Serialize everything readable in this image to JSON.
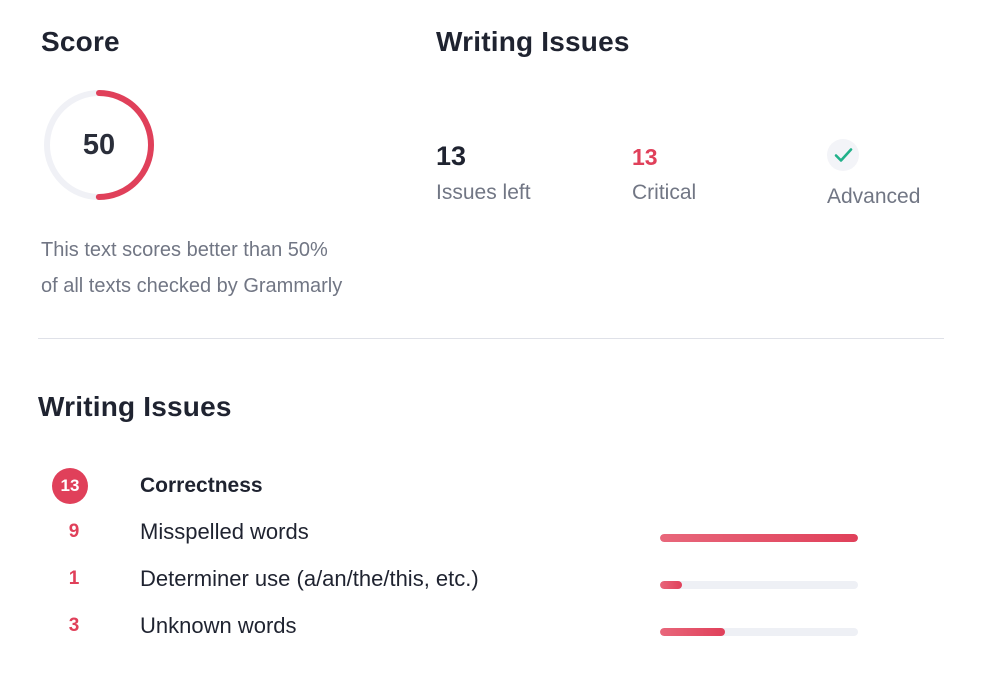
{
  "score": {
    "title": "Score",
    "value": "50",
    "progress": 0.5,
    "description_line1": "This text scores better than 50%",
    "description_line2": "of all texts checked by Grammarly"
  },
  "summary": {
    "title": "Writing Issues",
    "issues_left_value": "13",
    "issues_left_label": "Issues left",
    "critical_value": "13",
    "critical_label": "Critical",
    "advanced_label": "Advanced",
    "advanced_icon": "check-icon"
  },
  "issues": {
    "title": "Writing Issues",
    "category": {
      "count": "13",
      "label": "Correctness"
    },
    "items": [
      {
        "count": "9",
        "label": "Misspelled words",
        "fraction": 1.0
      },
      {
        "count": "1",
        "label": "Determiner use (a/an/the/this, etc.)",
        "fraction": 0.11
      },
      {
        "count": "3",
        "label": "Unknown words",
        "fraction": 0.33
      }
    ]
  },
  "colors": {
    "accent": "#e0405a",
    "check": "#21b18a",
    "track": "#eef0f5",
    "muted_text": "#717684",
    "text": "#1f2330"
  }
}
